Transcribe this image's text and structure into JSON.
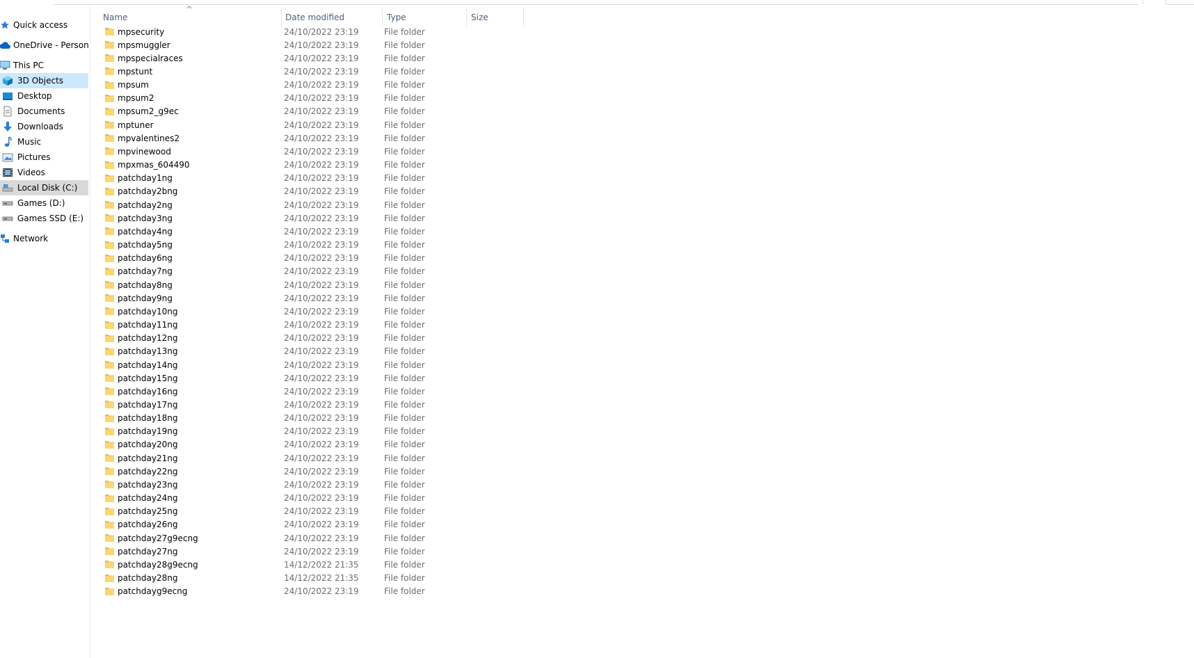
{
  "navigation": {
    "items": [
      {
        "label": "Quick access",
        "icon": "star-pin-icon",
        "level": 0
      },
      {
        "label": "OneDrive - Personal",
        "icon": "cloud-icon",
        "level": 0
      },
      {
        "label": "This PC",
        "icon": "computer-icon",
        "level": 0
      },
      {
        "label": "3D Objects",
        "icon": "cube-icon",
        "level": 1,
        "state": "selected"
      },
      {
        "label": "Desktop",
        "icon": "desktop-icon",
        "level": 1
      },
      {
        "label": "Documents",
        "icon": "document-icon",
        "level": 1
      },
      {
        "label": "Downloads",
        "icon": "download-arrow-icon",
        "level": 1
      },
      {
        "label": "Music",
        "icon": "music-note-icon",
        "level": 1
      },
      {
        "label": "Pictures",
        "icon": "picture-icon",
        "level": 1
      },
      {
        "label": "Videos",
        "icon": "film-icon",
        "level": 1
      },
      {
        "label": "Local Disk (C:)",
        "icon": "windows-drive-icon",
        "level": 1,
        "state": "hover"
      },
      {
        "label": "Games (D:)",
        "icon": "drive-icon",
        "level": 1
      },
      {
        "label": "Games SSD (E:)",
        "icon": "drive-icon",
        "level": 1
      },
      {
        "label": "Network",
        "icon": "network-icon",
        "level": 0
      }
    ]
  },
  "columns": {
    "name": "Name",
    "date_modified": "Date modified",
    "type": "Type",
    "size": "Size",
    "sort": "name-ascending"
  },
  "colors": {
    "selected_bg": "#cce8ff",
    "hover_bg": "#d9d9d9",
    "header_text": "#4c607a",
    "secondary_text": "#6d6d6d",
    "folder": "#f8d775"
  },
  "files": [
    {
      "name": "mpsecurity",
      "date": "24/10/2022 23:19",
      "type": "File folder"
    },
    {
      "name": "mpsmuggler",
      "date": "24/10/2022 23:19",
      "type": "File folder"
    },
    {
      "name": "mpspecialraces",
      "date": "24/10/2022 23:19",
      "type": "File folder"
    },
    {
      "name": "mpstunt",
      "date": "24/10/2022 23:19",
      "type": "File folder"
    },
    {
      "name": "mpsum",
      "date": "24/10/2022 23:19",
      "type": "File folder"
    },
    {
      "name": "mpsum2",
      "date": "24/10/2022 23:19",
      "type": "File folder"
    },
    {
      "name": "mpsum2_g9ec",
      "date": "24/10/2022 23:19",
      "type": "File folder"
    },
    {
      "name": "mptuner",
      "date": "24/10/2022 23:19",
      "type": "File folder"
    },
    {
      "name": "mpvalentines2",
      "date": "24/10/2022 23:19",
      "type": "File folder"
    },
    {
      "name": "mpvinewood",
      "date": "24/10/2022 23:19",
      "type": "File folder"
    },
    {
      "name": "mpxmas_604490",
      "date": "24/10/2022 23:19",
      "type": "File folder"
    },
    {
      "name": "patchday1ng",
      "date": "24/10/2022 23:19",
      "type": "File folder"
    },
    {
      "name": "patchday2bng",
      "date": "24/10/2022 23:19",
      "type": "File folder"
    },
    {
      "name": "patchday2ng",
      "date": "24/10/2022 23:19",
      "type": "File folder"
    },
    {
      "name": "patchday3ng",
      "date": "24/10/2022 23:19",
      "type": "File folder"
    },
    {
      "name": "patchday4ng",
      "date": "24/10/2022 23:19",
      "type": "File folder"
    },
    {
      "name": "patchday5ng",
      "date": "24/10/2022 23:19",
      "type": "File folder"
    },
    {
      "name": "patchday6ng",
      "date": "24/10/2022 23:19",
      "type": "File folder"
    },
    {
      "name": "patchday7ng",
      "date": "24/10/2022 23:19",
      "type": "File folder"
    },
    {
      "name": "patchday8ng",
      "date": "24/10/2022 23:19",
      "type": "File folder"
    },
    {
      "name": "patchday9ng",
      "date": "24/10/2022 23:19",
      "type": "File folder"
    },
    {
      "name": "patchday10ng",
      "date": "24/10/2022 23:19",
      "type": "File folder"
    },
    {
      "name": "patchday11ng",
      "date": "24/10/2022 23:19",
      "type": "File folder"
    },
    {
      "name": "patchday12ng",
      "date": "24/10/2022 23:19",
      "type": "File folder"
    },
    {
      "name": "patchday13ng",
      "date": "24/10/2022 23:19",
      "type": "File folder"
    },
    {
      "name": "patchday14ng",
      "date": "24/10/2022 23:19",
      "type": "File folder"
    },
    {
      "name": "patchday15ng",
      "date": "24/10/2022 23:19",
      "type": "File folder"
    },
    {
      "name": "patchday16ng",
      "date": "24/10/2022 23:19",
      "type": "File folder"
    },
    {
      "name": "patchday17ng",
      "date": "24/10/2022 23:19",
      "type": "File folder"
    },
    {
      "name": "patchday18ng",
      "date": "24/10/2022 23:19",
      "type": "File folder"
    },
    {
      "name": "patchday19ng",
      "date": "24/10/2022 23:19",
      "type": "File folder"
    },
    {
      "name": "patchday20ng",
      "date": "24/10/2022 23:19",
      "type": "File folder"
    },
    {
      "name": "patchday21ng",
      "date": "24/10/2022 23:19",
      "type": "File folder"
    },
    {
      "name": "patchday22ng",
      "date": "24/10/2022 23:19",
      "type": "File folder"
    },
    {
      "name": "patchday23ng",
      "date": "24/10/2022 23:19",
      "type": "File folder"
    },
    {
      "name": "patchday24ng",
      "date": "24/10/2022 23:19",
      "type": "File folder"
    },
    {
      "name": "patchday25ng",
      "date": "24/10/2022 23:19",
      "type": "File folder"
    },
    {
      "name": "patchday26ng",
      "date": "24/10/2022 23:19",
      "type": "File folder"
    },
    {
      "name": "patchday27g9ecng",
      "date": "24/10/2022 23:19",
      "type": "File folder"
    },
    {
      "name": "patchday27ng",
      "date": "24/10/2022 23:19",
      "type": "File folder"
    },
    {
      "name": "patchday28g9ecng",
      "date": "14/12/2022 21:35",
      "type": "File folder"
    },
    {
      "name": "patchday28ng",
      "date": "14/12/2022 21:35",
      "type": "File folder"
    },
    {
      "name": "patchdayg9ecng",
      "date": "24/10/2022 23:19",
      "type": "File folder"
    }
  ]
}
